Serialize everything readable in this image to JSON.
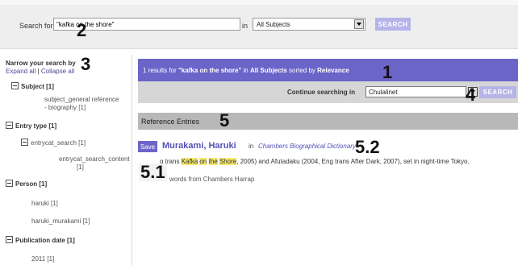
{
  "search": {
    "label": "Search for",
    "query_value": "\"kafka on the shore\"",
    "in_label": "in",
    "subject_selected": "All Subjects",
    "button": "SEARCH"
  },
  "sidebar": {
    "title": "Narrow your search by",
    "expand_all": "Expand all",
    "separator": "|",
    "collapse_all": "Collapse all",
    "facets": [
      {
        "label": "Subject [1]",
        "items": [
          "subject_general reference",
          "- biography [1]"
        ]
      },
      {
        "label": "Entry type [1]",
        "sub_label": "entrycat_search [1]",
        "items": [
          "entrycat_search_content",
          "[1]"
        ]
      },
      {
        "label": "Person [1]",
        "items": [
          "haruki [1]",
          "haruki_murakami [1]"
        ]
      },
      {
        "label": "Publication date [1]",
        "items": [
          "2011 [1]"
        ]
      }
    ]
  },
  "results": {
    "summary_prefix": "1 results for ",
    "query_bold": "\"kafka on the shore\"",
    "summary_mid": " in ",
    "scope_bold": "All Subjects",
    "summary_sorted": " sorted by ",
    "sort_bold": "Relevance",
    "continue_label": "Continue searching in",
    "continue_selected": "Chulalinet",
    "continue_button": "SEARCH",
    "section_title": "Reference Entries"
  },
  "entry": {
    "save_label": "Save",
    "title": "Murakami, Haruki",
    "in_word": "in",
    "source": "Chambers Biographical Dictionary",
    "snippet_pre": "g trans ",
    "hl1": "Kafka",
    "hl2": "on",
    "hl3": "the",
    "hl4": "Shore",
    "snippet_post": ", 2005) and Afutadaku (2004, Eng trans After Dark, 2007), set in night-time Tokyo.",
    "word_count": "words from Chambers Harrap"
  },
  "markers": {
    "m1": "1",
    "m2": "2",
    "m3": "3",
    "m4": "4",
    "m5": "5",
    "m51": "5.1",
    "m52": "5.2"
  },
  "colors": {
    "accent": "#6b65c9",
    "button_light": "#b6b4e8",
    "highlight": "#f4e96a",
    "grey_bar": "#b8b8b8"
  }
}
